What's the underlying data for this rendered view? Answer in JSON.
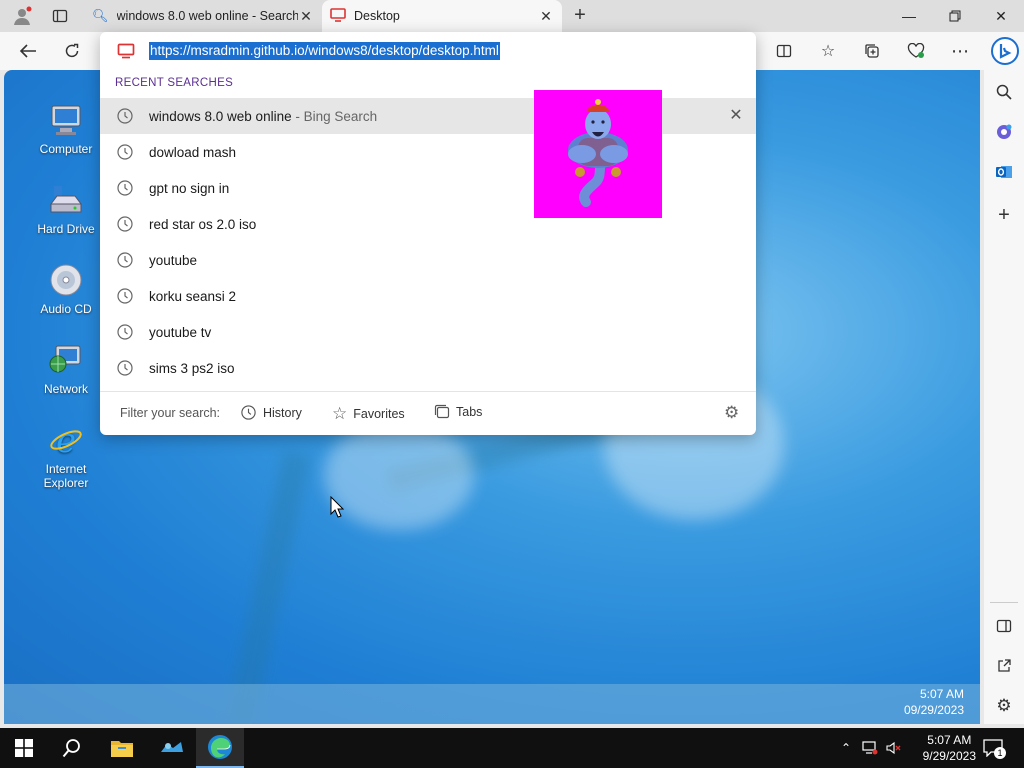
{
  "browser": {
    "tabs": [
      {
        "label": "windows 8.0 web online - Search",
        "icon": "search-icon"
      },
      {
        "label": "Desktop",
        "icon": "monitor-icon"
      }
    ],
    "url": "https://msradmin.github.io/windows8/desktop/desktop.html"
  },
  "dropdown": {
    "recent_header": "RECENT SEARCHES",
    "suggestions": [
      {
        "text": "windows 8.0 web online",
        "source": "- Bing Search"
      },
      {
        "text": "dowload mash"
      },
      {
        "text": "gpt no sign in"
      },
      {
        "text": "red star os 2.0 iso"
      },
      {
        "text": "youtube"
      },
      {
        "text": "korku seansi 2"
      },
      {
        "text": "youtube tv"
      },
      {
        "text": "sims 3 ps2 iso"
      }
    ],
    "filter_label": "Filter your search:",
    "filters": [
      "History",
      "Favorites",
      "Tabs"
    ]
  },
  "desktop": {
    "icons": [
      "Computer",
      "Hard Drive",
      "Audio CD",
      "Network",
      "Internet Explorer"
    ],
    "time": "5:07 AM",
    "date": "09/29/2023"
  },
  "taskbar": {
    "time": "5:07 AM",
    "date": "9/29/2023",
    "notification_count": "1"
  },
  "colors": {
    "accent": "#1b6fd0",
    "recent_header": "#5b2f91",
    "genie_bg": "#ff00ff"
  }
}
